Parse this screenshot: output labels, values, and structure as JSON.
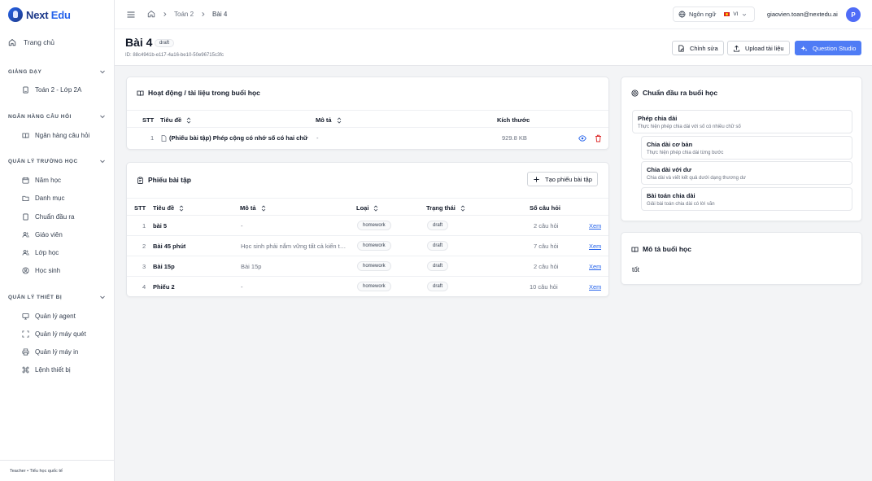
{
  "brand": {
    "name_dark": "Next",
    "name_light": " Edu"
  },
  "sidebar": {
    "home": "Trang chủ",
    "sections": [
      {
        "label": "GIẢNG DẠY",
        "items": [
          "Toán 2 - Lớp 2A"
        ]
      },
      {
        "label": "NGÂN HÀNG CÂU HỎI",
        "items": [
          "Ngân hàng câu hỏi"
        ]
      },
      {
        "label": "QUẢN LÝ TRƯỜNG HỌC",
        "items": [
          "Năm học",
          "Danh mục",
          "Chuẩn đầu ra",
          "Giáo viên",
          "Lớp học",
          "Học sinh"
        ]
      },
      {
        "label": "QUẢN LÝ THIẾT BỊ",
        "items": [
          "Quản lý agent",
          "Quản lý máy quét",
          "Quản lý máy in",
          "Lệnh thiết bị"
        ]
      }
    ],
    "footer": "Teacher • Tiểu học quốc tế"
  },
  "topbar": {
    "breadcrumb": [
      "Toán 2",
      "Bài 4"
    ],
    "language_label": "Ngôn ngữ",
    "language_code": "VI",
    "email": "giaovien.toan@nextedu.ai",
    "avatar_initial": "P"
  },
  "page": {
    "title": "Bài 4",
    "status": "draft",
    "id_text": "ID: 88c4941b-e117-4a16-be10-50e96715c3fc",
    "actions": {
      "edit": "Chỉnh sửa",
      "upload": "Upload tài liệu",
      "studio": "Question Studio"
    }
  },
  "activities": {
    "title": "Hoạt động / tài liệu trong buổi học",
    "headers": {
      "stt": "STT",
      "title": "Tiêu đề",
      "desc": "Mô tả",
      "size": "Kích thước"
    },
    "rows": [
      {
        "stt": "1",
        "title": "(Phiếu bài tập) Phép cộng có nhớ số có hai chữ số",
        "desc": "-",
        "size": "929.8 KB"
      }
    ]
  },
  "worksheets": {
    "title": "Phiếu bài tập",
    "create_label": "Tạo phiếu bài tập",
    "headers": {
      "stt": "STT",
      "title": "Tiêu đề",
      "desc": "Mô tả",
      "type": "Loại",
      "status": "Trạng thái",
      "count": "Số câu hỏi"
    },
    "rows": [
      {
        "stt": "1",
        "title": "bài 5",
        "desc": "-",
        "type": "homework",
        "status": "draft",
        "count": "2 câu hỏi",
        "action": "Xem"
      },
      {
        "stt": "2",
        "title": "Bài 45 phút",
        "desc": "Học sinh phải nắm vững tất cả kiến thức",
        "type": "homework",
        "status": "draft",
        "count": "7 câu hỏi",
        "action": "Xem"
      },
      {
        "stt": "3",
        "title": "Bài 15p",
        "desc": "Bài 15p",
        "type": "homework",
        "status": "draft",
        "count": "2 câu hỏi",
        "action": "Xem"
      },
      {
        "stt": "4",
        "title": "Phiếu 2",
        "desc": "-",
        "type": "homework",
        "status": "draft",
        "count": "10 câu hỏi",
        "action": "Xem"
      }
    ]
  },
  "outcomes": {
    "title": "Chuẩn đầu ra buổi học",
    "items": [
      {
        "title": "Phép chia dài",
        "desc": "Thực hiện phép chia dài với số có nhiều chữ số"
      },
      {
        "title": "Chia dài cơ bản",
        "desc": "Thực hiện phép chia dài từng bước"
      },
      {
        "title": "Chia dài với dư",
        "desc": "Chia dài và viết kết quả dưới dạng thương dư"
      },
      {
        "title": "Bài toán chia dài",
        "desc": "Giải bài toán chia dài có lời văn"
      }
    ]
  },
  "lesson_desc": {
    "title": "Mô tả buổi học",
    "text": "tốt"
  },
  "colors": {
    "primary": "#4f7cf5",
    "brand": "#1e3a8a",
    "link": "#2563eb",
    "avatar": "#4f6cf7",
    "danger": "#dc2626"
  }
}
